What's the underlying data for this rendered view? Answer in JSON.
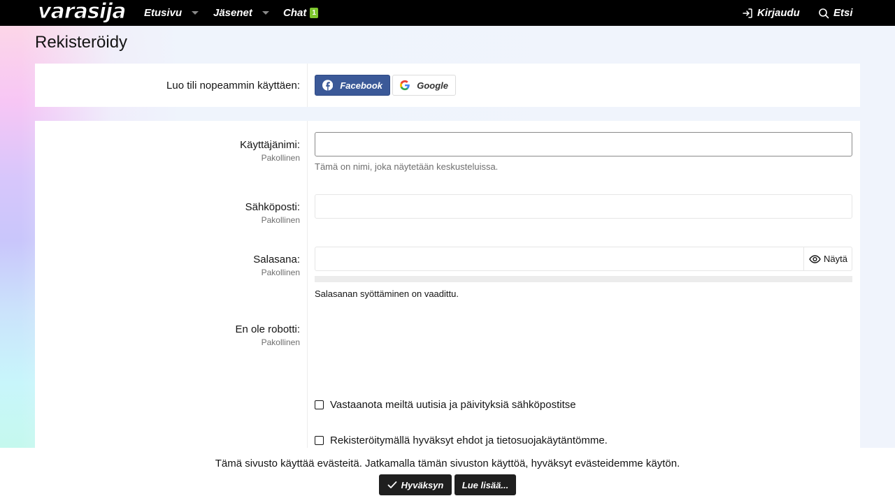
{
  "header": {
    "logo": "varasija",
    "nav": [
      {
        "label": "Etusivu",
        "has_dropdown": true
      },
      {
        "label": "Jäsenet",
        "has_dropdown": true
      },
      {
        "label": "Chat",
        "badge": "1"
      }
    ],
    "login_label": "Kirjaudu",
    "search_label": "Etsi"
  },
  "page": {
    "title": "Rekisteröidy"
  },
  "social": {
    "label": "Luo tili nopeammin käyttäen:",
    "facebook": "Facebook",
    "google": "Google"
  },
  "form": {
    "required": "Pakollinen",
    "username": {
      "label": "Käyttäjänimi:",
      "value": "",
      "hint": "Tämä on nimi, joka näytetään keskusteluissa."
    },
    "email": {
      "label": "Sähköposti:",
      "value": ""
    },
    "password": {
      "label": "Salasana:",
      "value": "",
      "show_label": "Näytä",
      "strength_text": "Salasanan syöttäminen on vaadittu.",
      "strength_fraction": 0
    },
    "captcha": {
      "label": "En ole robotti:"
    },
    "newsletter": {
      "label": "Vastaanota meiltä uutisia ja päivityksiä sähköpostitse",
      "checked": false
    },
    "terms": {
      "label": "Rekisteröitymällä hyväksyt ehdot ja tietosuojakäytäntömme.",
      "checked": false
    }
  },
  "cookie": {
    "text": "Tämä sivusto käyttää evästeitä. Jatkamalla tämän sivuston käyttöä, hyväksyt evästeidemme käytön.",
    "accept": "Hyväksyn",
    "more": "Lue lisää..."
  },
  "colors": {
    "topbar": "#000000",
    "facebook": "#3b5998",
    "badge": "#7dc62e",
    "cookie_button": "#1f1f1f"
  }
}
